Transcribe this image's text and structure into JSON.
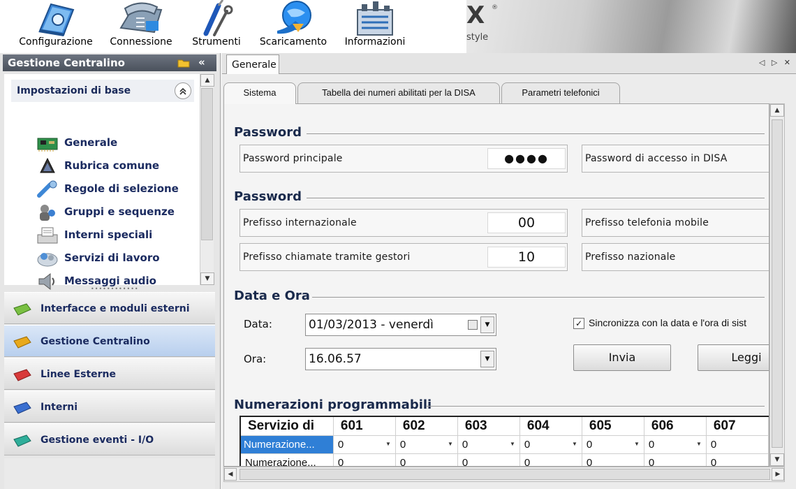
{
  "toolbar": {
    "buttons": [
      {
        "label": "Configurazione",
        "icon": "configuration-book-icon"
      },
      {
        "label": "Connessione",
        "icon": "telephone-connection-icon"
      },
      {
        "label": "Strumenti",
        "icon": "tools-screwdriver-icon"
      },
      {
        "label": "Scaricamento",
        "icon": "download-globe-icon"
      },
      {
        "label": "Informazioni",
        "icon": "information-building-icon"
      }
    ],
    "banner_logo": "X",
    "banner_reg": "®",
    "banner_sub": "style"
  },
  "left_panel": {
    "title": "Gestione Centralino",
    "section_label": "Impostazioni di base",
    "collapse_glyph": "«",
    "items": [
      {
        "label": "Generale",
        "icon": "circuit-board-icon"
      },
      {
        "label": "Rubrica comune",
        "icon": "address-book-icon"
      },
      {
        "label": "Regole di selezione",
        "icon": "selection-rules-icon"
      },
      {
        "label": "Gruppi e sequenze",
        "icon": "groups-sequences-icon"
      },
      {
        "label": "Interni speciali",
        "icon": "fax-machine-icon"
      },
      {
        "label": "Servizi di lavoro",
        "icon": "work-services-icon"
      },
      {
        "label": "Messaggi audio",
        "icon": "speaker-icon"
      }
    ],
    "groups": [
      {
        "label": "Interfacce e moduli esterni",
        "color": "#7ac043",
        "active": false
      },
      {
        "label": "Gestione Centralino",
        "color": "#e8a91c",
        "active": true
      },
      {
        "label": "Linee Esterne",
        "color": "#d83a3a",
        "active": false
      },
      {
        "label": "Interni",
        "color": "#3a6fd0",
        "active": false
      },
      {
        "label": "Gestione eventi - I/O",
        "color": "#2fae9a",
        "active": false
      }
    ]
  },
  "main": {
    "doc_tab": "Generale",
    "tabs": [
      {
        "label": "Sistema",
        "active": true
      },
      {
        "label": "Tabella dei numeri abilitati per la DISA",
        "active": false
      },
      {
        "label": "Parametri telefonici",
        "active": false
      }
    ],
    "sections": {
      "password1": "Password",
      "password2": "Password",
      "datetime": "Data e Ora",
      "numbering": "Numerazioni programmabili"
    },
    "fields": {
      "main_password_label": "Password principale",
      "main_password_value": "●●●●",
      "disa_password_label": "Password di accesso in DISA",
      "intl_prefix_label": "Prefisso internazionale",
      "intl_prefix_value": "00",
      "mobile_prefix_label": "Prefisso telefonia mobile",
      "carrier_prefix_label": "Prefisso chiamate tramite gestori",
      "carrier_prefix_value": "10",
      "national_prefix_label": "Prefisso nazionale",
      "date_label": "Data:",
      "date_value": "01/03/2013 -  venerdì",
      "time_label": "Ora:",
      "time_value": "16.06.57",
      "sync_label": "Sincronizza con la data e l'ora di sist",
      "sync_checked": true,
      "send_button": "Invia",
      "read_button": "Leggi"
    },
    "grid": {
      "header": [
        "Servizio di",
        "601",
        "602",
        "603",
        "604",
        "605",
        "606",
        "607"
      ],
      "rows": [
        [
          "Numerazione...",
          "0",
          "0",
          "0",
          "0",
          "0",
          "0",
          "0"
        ],
        [
          "Numerazione...",
          "0",
          "0",
          "0",
          "0",
          "0",
          "0",
          "0"
        ]
      ]
    }
  }
}
